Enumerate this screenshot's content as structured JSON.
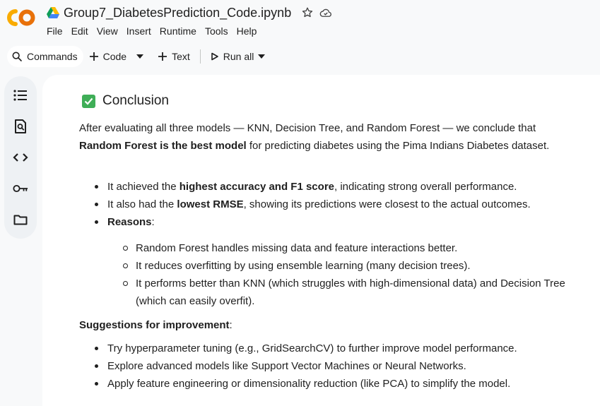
{
  "app": {
    "title": "Group7_DiabetesPrediction_Code.ipynb",
    "menu": [
      "File",
      "Edit",
      "View",
      "Insert",
      "Runtime",
      "Tools",
      "Help"
    ]
  },
  "toolbar": {
    "commands": "Commands",
    "code": "Code",
    "text": "Text",
    "run_all": "Run all"
  },
  "rail_icons": [
    "table-of-contents-icon",
    "find-icon",
    "code-snippets-icon",
    "secrets-key-icon",
    "files-folder-icon"
  ],
  "content": {
    "heading": "Conclusion",
    "intro_1": "After evaluating all three models — KNN, Decision Tree, and Random Forest — we conclude that ",
    "intro_bold": "Random Forest is the best model",
    "intro_2": " for predicting diabetes using the Pima Indians Diabetes dataset.",
    "bullets": [
      {
        "pre": "It achieved the ",
        "bold": "highest accuracy and F1 score",
        "post": ", indicating strong overall performance."
      },
      {
        "pre": "It also had the ",
        "bold": "lowest RMSE",
        "post": ", showing its predictions were closest to the actual outcomes."
      },
      {
        "pre": "",
        "bold": "Reasons",
        "post": ":"
      }
    ],
    "reasons": [
      "Random Forest handles missing data and feature interactions better.",
      "It reduces overfitting by using ensemble learning (many decision trees).",
      "It performs better than KNN (which struggles with high-dimensional data) and Decision Tree (which can easily overfit)."
    ],
    "suggestions_title": "Suggestions for improvement",
    "suggestions_colon": ":",
    "suggestions": [
      "Try hyperparameter tuning (e.g., GridSearchCV) to further improve model performance.",
      "Explore advanced models like Support Vector Machines or Neural Networks.",
      "Apply feature engineering or dimensionality reduction (like PCA) to simplify the model."
    ]
  },
  "colors": {
    "accent_orange": "#f9ab00",
    "check_green": "#3fae57"
  }
}
